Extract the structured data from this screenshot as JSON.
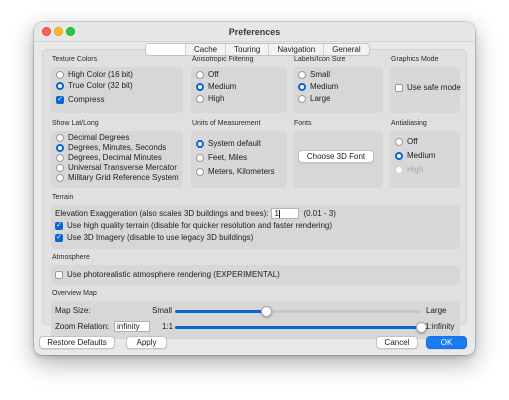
{
  "window": {
    "title": "Preferences"
  },
  "tabs": [
    {
      "label": ""
    },
    {
      "label": "Cache"
    },
    {
      "label": "Touring"
    },
    {
      "label": "Navigation"
    },
    {
      "label": "General"
    }
  ],
  "texture_colors": {
    "title": "Texture Colors",
    "options": [
      "High Color (16 bit)",
      "True Color (32 bit)"
    ],
    "selected": "True Color (32 bit)",
    "compress_label": "Compress",
    "compress_checked": true
  },
  "anisotropic": {
    "title": "Anisotropic Filtering",
    "options": [
      "Off",
      "Medium",
      "High"
    ],
    "selected": "Medium"
  },
  "labels_icon_size": {
    "title": "Labels/Icon Size",
    "options": [
      "Small",
      "Medium",
      "Large"
    ],
    "selected": "Medium"
  },
  "graphics_mode": {
    "title": "Graphics Mode",
    "safe_mode_label": "Use safe mode",
    "safe_mode_checked": false
  },
  "show_lat_long": {
    "title": "Show Lat/Long",
    "options": [
      "Decimal Degrees",
      "Degrees, Minutes, Seconds",
      "Degrees, Decimal Minutes",
      "Universal Transverse Mercator",
      "Military Grid Reference System"
    ],
    "selected": "Degrees, Minutes, Seconds"
  },
  "units": {
    "title": "Units of Measurement",
    "options": [
      "System default",
      "Feet, Miles",
      "Meters, Kilometers"
    ],
    "selected": "System default"
  },
  "fonts": {
    "title": "Fonts",
    "button_label": "Choose 3D Font"
  },
  "antialiasing": {
    "title": "Antialiasing",
    "options": [
      "Off",
      "Medium",
      "High"
    ],
    "selected": "Medium",
    "disabled": [
      "High"
    ]
  },
  "terrain": {
    "title": "Terrain",
    "elevation_label": "Elevation Exaggeration (also scales 3D buildings and trees):",
    "elevation_value": "1",
    "elevation_range": "(0.01 - 3)",
    "high_quality_label": "Use high quality terrain (disable for quicker resolution and faster rendering)",
    "high_quality_checked": true,
    "imagery_label": "Use 3D Imagery (disable to use legacy 3D buildings)",
    "imagery_checked": true
  },
  "atmosphere": {
    "title": "Atmosphere",
    "photorealistic_label": "Use photorealistic atmosphere rendering (EXPERIMENTAL)",
    "photorealistic_checked": false
  },
  "overview_map": {
    "title": "Overview Map",
    "map_size_label": "Map Size:",
    "map_size_min": "Small",
    "map_size_max": "Large",
    "map_size_value": 0.37,
    "zoom_relation_label": "Zoom Relation:",
    "zoom_relation_value": "infinity",
    "zoom_min": "1:1",
    "zoom_max": "1:infinity",
    "zoom_value": 1.0
  },
  "footer": {
    "restore_label": "Restore Defaults",
    "apply_label": "Apply",
    "cancel_label": "Cancel",
    "ok_label": "OK"
  },
  "colors": {
    "accent": "#0a64d8",
    "primary_button": "#1a7bf2",
    "close": "#fe5f57",
    "minimize": "#febc2e",
    "maximize": "#28c840"
  }
}
